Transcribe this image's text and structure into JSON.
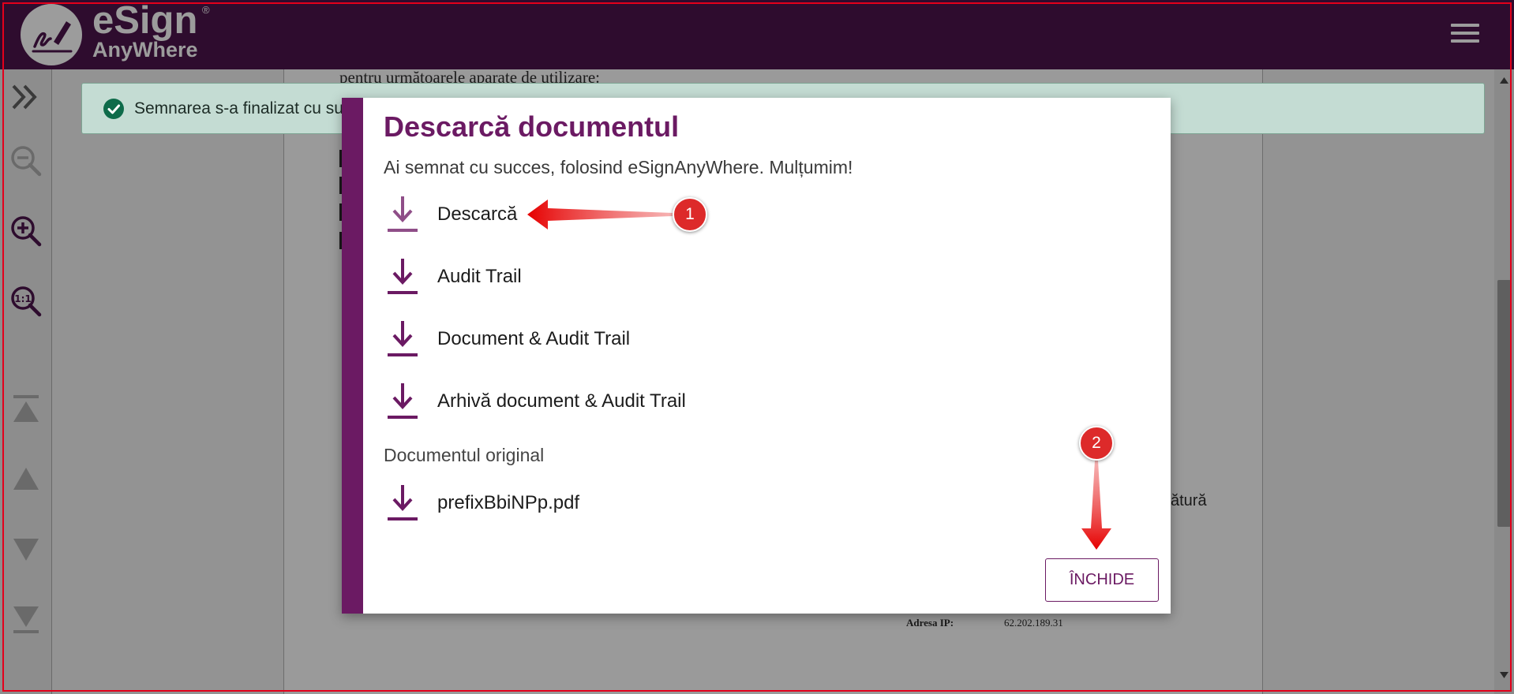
{
  "app": {
    "logo_title": "eSign",
    "logo_reg": "®",
    "logo_subtitle": "AnyWhere"
  },
  "document": {
    "line_top": "pentru următoarele aparate de utilizare:",
    "line_right": "ătură",
    "ip_label": "Adresa IP:",
    "ip_value": "62.202.189.31"
  },
  "banner": {
    "text": "Semnarea s-a finalizat cu su"
  },
  "modal": {
    "title": "Descarcă documentul",
    "subtitle": "Ai semnat cu succes, folosind eSignAnyWhere. Mulțumim!",
    "downloads": [
      {
        "label": "Descarcă"
      },
      {
        "label": "Audit Trail"
      },
      {
        "label": "Document & Audit Trail"
      },
      {
        "label": "Arhivă document & Audit Trail"
      }
    ],
    "original_section_label": "Documentul original",
    "original_file": {
      "label": "prefixBbiNPp.pdf"
    },
    "close_label": "ÎNCHIDE"
  },
  "annotations": {
    "badge_1": "1",
    "badge_2": "2",
    "color": "#dd2a2a"
  },
  "colors": {
    "header_bg": "#2e0c2e",
    "accent": "#6b1a63",
    "banner_bg": "#c4dcd3",
    "success_icon": "#0e6b4a"
  },
  "icons": {
    "toolbar": [
      "expand-panel-icon",
      "zoom-out-icon",
      "zoom-in-icon",
      "zoom-actual-size-icon",
      "first-page-icon",
      "previous-page-icon",
      "next-page-icon",
      "last-page-icon"
    ],
    "header": [
      "logo-icon",
      "hamburger-menu-icon"
    ],
    "modal": [
      "download-icon"
    ],
    "banner": [
      "check-circle-icon"
    ]
  }
}
